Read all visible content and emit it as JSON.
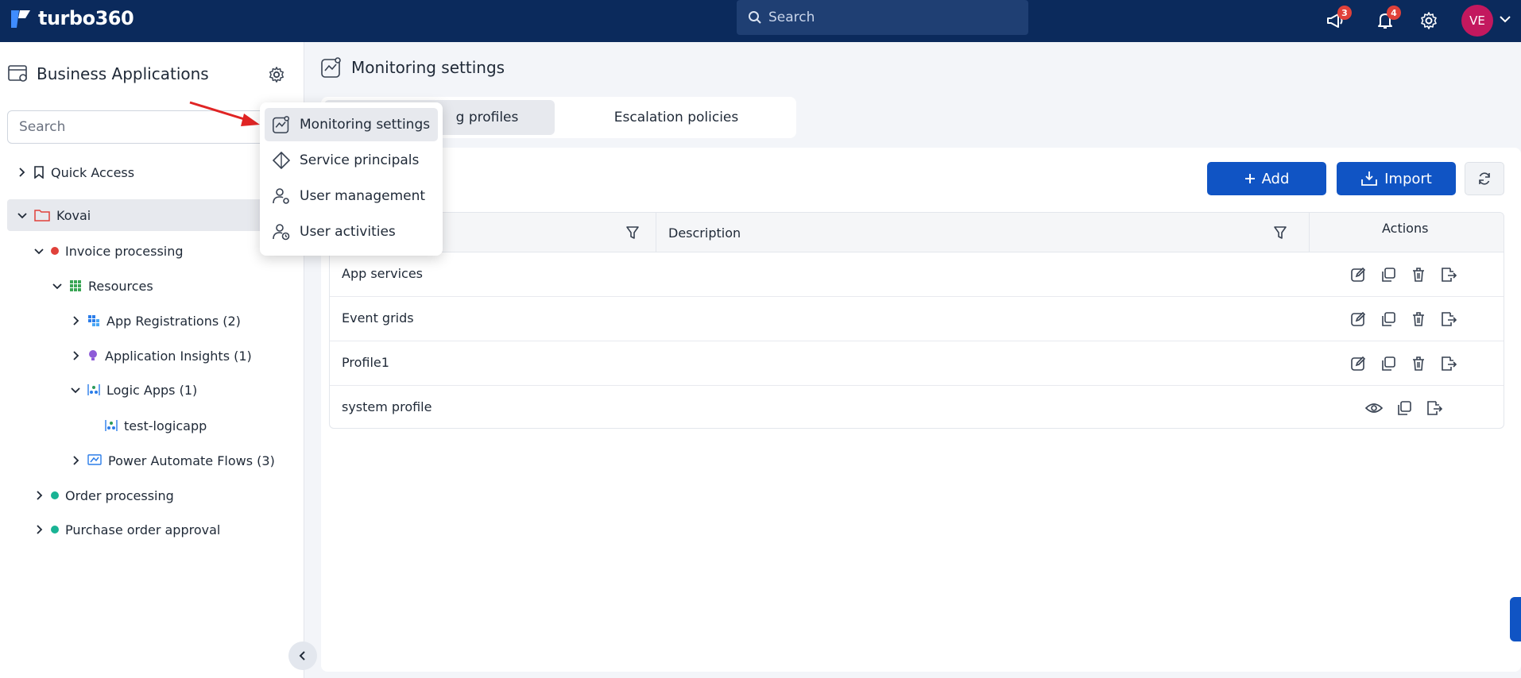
{
  "app": {
    "brand": "turbo360"
  },
  "topbar": {
    "search_placeholder": "Search",
    "announcements_count": "3",
    "notifications_count": "4",
    "avatar_initials": "VE"
  },
  "sidebar": {
    "title": "Business Applications",
    "search_placeholder": "Search",
    "tree": {
      "quick_access": "Quick Access",
      "kovai": "Kovai",
      "invoice": "Invoice processing",
      "resources": "Resources",
      "app_reg": "App Registrations (2)",
      "app_insights": "Application Insights (1)",
      "logic_apps": "Logic Apps (1)",
      "test_logicapp": "test-logicapp",
      "power_automate": "Power Automate Flows (3)",
      "order": "Order processing",
      "purchase": "Purchase order approval"
    }
  },
  "main": {
    "title": "Monitoring settings",
    "tabs": {
      "profiles": "g profiles",
      "escalation": "Escalation policies"
    },
    "buttons": {
      "add": "Add",
      "import": "Import"
    },
    "table": {
      "col_description": "Description",
      "col_actions": "Actions",
      "rows": [
        {
          "name": "App services"
        },
        {
          "name": "Event grids"
        },
        {
          "name": "Profile1"
        },
        {
          "name": "system profile"
        }
      ]
    }
  },
  "dropdown": {
    "items": [
      {
        "label": "Monitoring settings"
      },
      {
        "label": "Service principals"
      },
      {
        "label": "User management"
      },
      {
        "label": "User activities"
      }
    ]
  },
  "colors": {
    "topbar": "#0b2a5c",
    "primary": "#1054c4",
    "status_red": "#e0413a",
    "status_green": "#19b394",
    "avatar": "#c3185e"
  }
}
